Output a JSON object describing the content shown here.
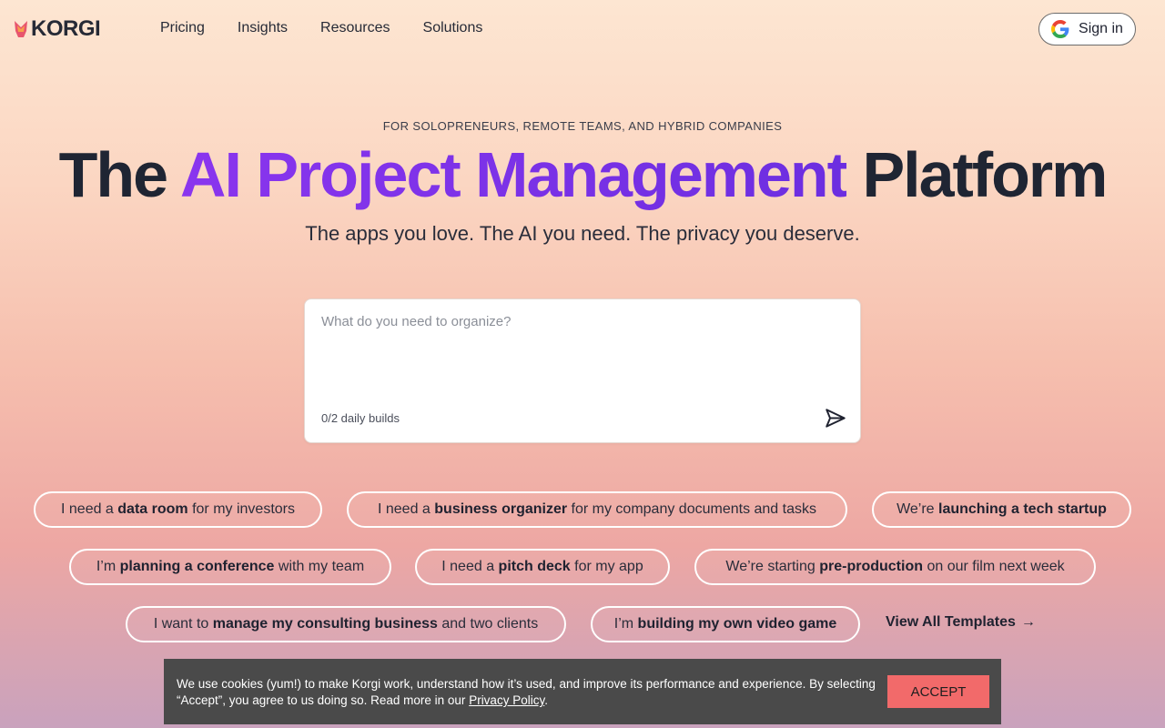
{
  "brand": {
    "name": "KORGI"
  },
  "nav": {
    "items": [
      "Pricing",
      "Insights",
      "Resources",
      "Solutions"
    ]
  },
  "signin": {
    "label": "Sign in",
    "icon": "google-icon"
  },
  "hero": {
    "eyebrow": "FOR SOLOPRENEURS, REMOTE TEAMS, AND HYBRID COMPANIES",
    "headline_pre": "The ",
    "headline_accent": "AI Project Management",
    "headline_post": " Platform",
    "subhead": "The apps you love. The AI you need. The privacy you deserve."
  },
  "prompt": {
    "placeholder": "What do you need to organize?",
    "value": "",
    "builds": "0/2 daily builds",
    "send_icon": "send-icon"
  },
  "chips": [
    {
      "pre": "I need a ",
      "bold": "data room",
      "post": " for my investors"
    },
    {
      "pre": "I need a ",
      "bold": "business organizer",
      "post": " for my company documents and tasks"
    },
    {
      "pre": "We’re ",
      "bold": "launching a tech startup",
      "post": ""
    },
    {
      "pre": "I’m ",
      "bold": "planning a conference",
      "post": " with my team"
    },
    {
      "pre": "I need a ",
      "bold": "pitch deck",
      "post": " for my app"
    },
    {
      "pre": "We’re starting ",
      "bold": "pre-production",
      "post": " on our film next week"
    },
    {
      "pre": "I want to ",
      "bold": "manage my consulting business",
      "post": " and two clients"
    },
    {
      "pre": "I’m ",
      "bold": "building my own video game",
      "post": ""
    }
  ],
  "view_all": {
    "label": "View All Templates",
    "arrow": "→"
  },
  "cookie": {
    "text_1": "We use cookies (yum!) to make Korgi work, understand how it’s used, and improve its performance and experience. By selecting “Accept”, you agree to us doing so. Read more in our ",
    "link": "Privacy Policy",
    "text_2": ".",
    "accept_label": "ACCEPT"
  },
  "colors": {
    "accent": "#7b32e8",
    "accept": "#f26a6a",
    "banner": "#4a4a4a",
    "logo": "#e8556d"
  }
}
